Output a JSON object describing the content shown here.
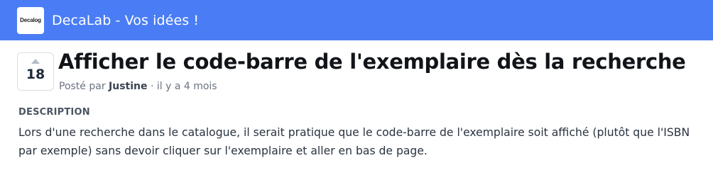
{
  "header": {
    "logo_text": "Decalog",
    "brand_title": "DecaLab - Vos idées !",
    "background_color": "#4a7df5"
  },
  "post": {
    "vote_count": "18",
    "upvote_icon": "triangle-up",
    "title": "Afficher le code-barre de l'exemplaire dès la recherche",
    "meta_prefix": "Posté par",
    "author": "Justine",
    "meta_suffix": "· il y a 4 mois"
  },
  "description": {
    "heading": "DESCRIPTION",
    "body": "Lors d'une recherche dans le catalogue, il serait pratique que le code-barre de l'exemplaire soit affiché (plutôt que l'ISBN par exemple) sans devoir cliquer sur l'exemplaire et aller en bas de page."
  }
}
